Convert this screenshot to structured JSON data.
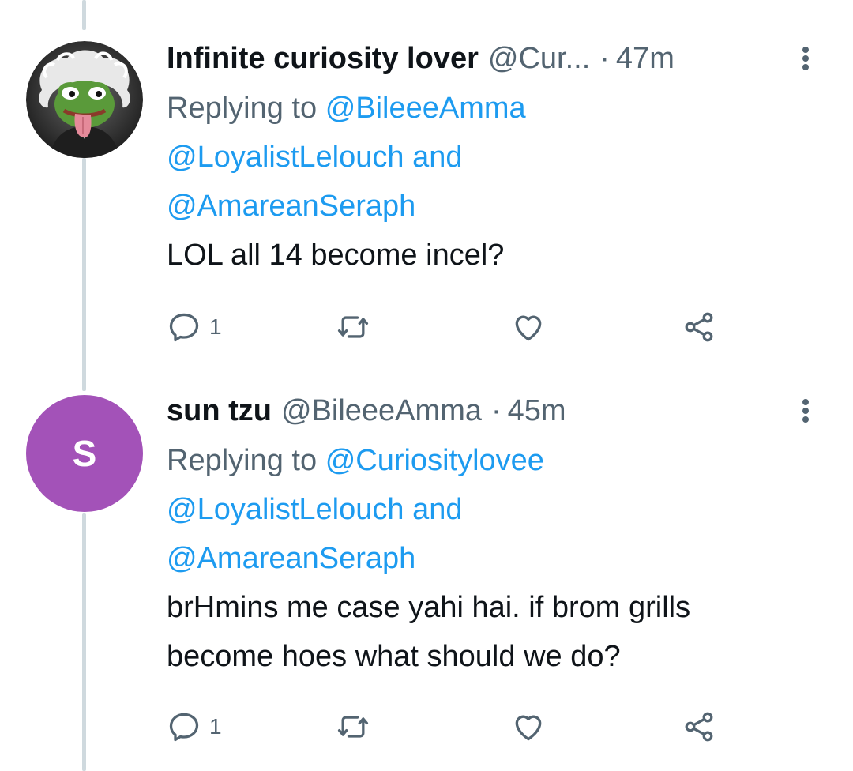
{
  "tweets": [
    {
      "display_name": "Infinite curiosity lover",
      "handle": "@Cur...",
      "dot": "·",
      "time": "47m",
      "avatar": {
        "type": "image",
        "desc_icon": "pepe-einstein-avatar"
      },
      "replying_prefix": "Replying to",
      "replying_mentions": [
        "@BileeeAmma",
        "@LoyalistLelouch",
        "@AmareanSeraph"
      ],
      "replying_and": "and",
      "text_lines": [
        "LOL all 14 become incel?"
      ],
      "reply_count": "1",
      "retweet_count": "",
      "like_count": ""
    },
    {
      "display_name": "sun tzu",
      "handle": "@BileeeAmma",
      "dot": "·",
      "time": "45m",
      "avatar": {
        "type": "letter",
        "letter": "S",
        "color": "#a352b8"
      },
      "replying_prefix": "Replying to",
      "replying_mentions": [
        "@Curiositylovee",
        "@LoyalistLelouch",
        "@AmareanSeraph"
      ],
      "replying_and": "and",
      "text_lines": [
        "brHmins me case yahi hai. if brom grills",
        "become hoes what should we do?"
      ],
      "reply_count": "1",
      "retweet_count": "",
      "like_count": ""
    }
  ],
  "colors": {
    "accent": "#1d9bf0",
    "secondary_text": "#536471",
    "primary_text": "#0f1419",
    "thread_line": "#cfd9de"
  }
}
